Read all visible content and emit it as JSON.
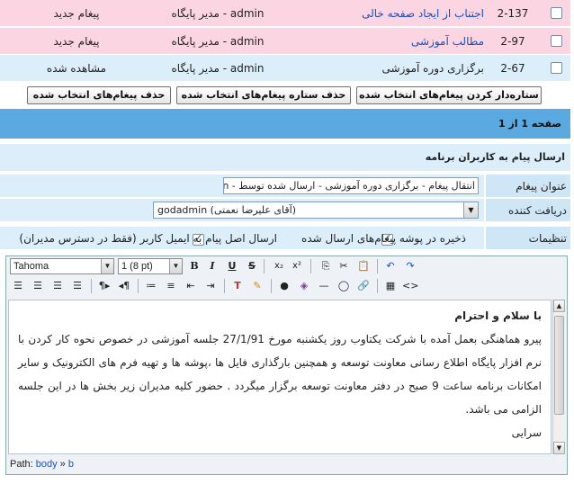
{
  "messages": [
    {
      "id": "2-137",
      "subject": "اجتناب از ایجاد صفحه خالی",
      "sender": "admin - مدیر پایگاه",
      "status": "پیغام جدید",
      "subject_is_link": true
    },
    {
      "id": "2-97",
      "subject": "مطالب آموزشی",
      "sender": "admin - مدیر پایگاه",
      "status": "پیغام جدید",
      "subject_is_link": true
    },
    {
      "id": "2-67",
      "subject": "برگزاری دوره آموزشی",
      "sender": "admin - مدیر پایگاه",
      "status": "مشاهده شده",
      "subject_is_link": false
    }
  ],
  "actions": {
    "star_selected": "ستاره‌دار کردن پیغام‌های انتخاب شده",
    "unstar_selected": "حذف ستاره پیغام‌های انتخاب شده",
    "delete_selected": "حذف پیغام‌های انتخاب شده"
  },
  "pager": {
    "text": "صفحه 1 از 1"
  },
  "compose": {
    "title": "ارسال پیام به کاربران برنامه",
    "subject_label": "عنوان پیغام",
    "subject_value": "انتقال پیغام - برگزاری دوره آموزشی - ارسال شده توسط - min",
    "recipient_label": "دریافت کننده",
    "recipient_value": "godadmin (آقای علیرضا نعمتی)",
    "settings_label": "تنظیمات",
    "save_sent_label": "ذخیره در پوشه پیغام‌های ارسال شده",
    "send_email_label": "ارسال اصل پیام به ایمیل کاربر (فقط در دسترس مدیران)",
    "save_sent_checked": true,
    "send_email_checked": true
  },
  "editor": {
    "font_family": "Tahoma",
    "font_size": "1 (8 pt)",
    "body_greeting": "با سلام و احترام",
    "body_text": "پیرو هماهنگی بعمل آمده با شرکت یکتاوب روز یکشنبه مورخ 27/1/91 جلسه آموزشی در خصوص نحوه کار کردن با نرم افزار پایگاه اطلاع رسانی معاونت توسعه و همچنین بارگذاری فایل ها ،پوشه ها و تهیه فرم های الکترونیک و سایر امکانات برنامه ساعت 9 صبح در دفتر معاونت توسعه برگزار میگردد . حضور کلیه مدیران زیر بخش ها در این جلسه الزامی می باشد.",
    "body_closing": "سرایی",
    "path_label": "Path:",
    "path_body": "body",
    "path_sep": "»",
    "path_b": "b"
  }
}
